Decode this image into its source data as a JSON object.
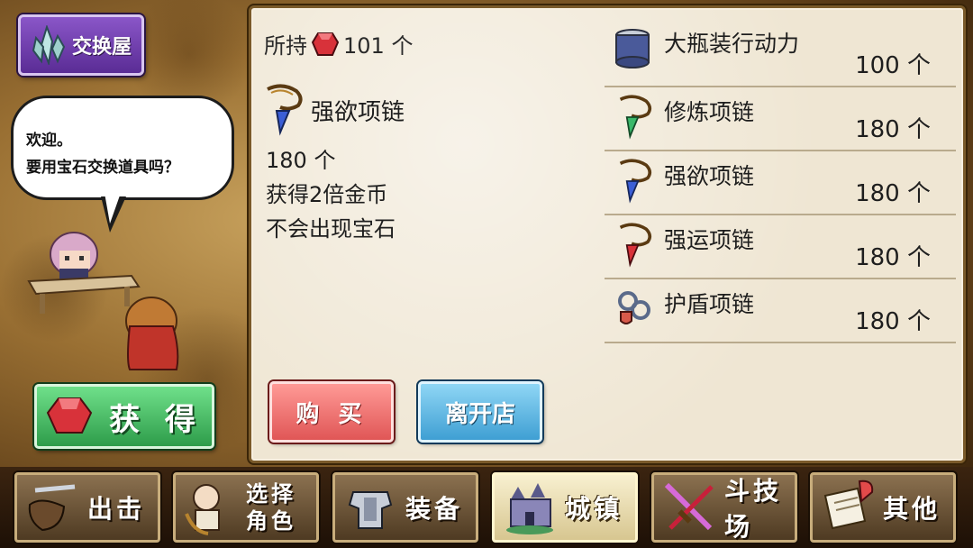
{
  "shop": {
    "title": "交换屋"
  },
  "npc": {
    "line1": "欢迎。",
    "line2": "要用宝石交换道具吗？"
  },
  "get_button": {
    "label": "获 得"
  },
  "owned": {
    "prefix": "所持",
    "amount": "101 个"
  },
  "selected": {
    "name": "强欲项链",
    "cost": "180 个",
    "effect1": "获得2倍金币",
    "effect2": "不会出现宝石"
  },
  "items": [
    {
      "name": "大瓶装行动力",
      "cost": "100 个",
      "icon": "potion-jar-icon"
    },
    {
      "name": "修炼项链",
      "cost": "180 个",
      "icon": "green-necklace-icon"
    },
    {
      "name": "强欲项链",
      "cost": "180 个",
      "icon": "blue-necklace-icon"
    },
    {
      "name": "强运项链",
      "cost": "180 个",
      "icon": "red-necklace-icon"
    },
    {
      "name": "护盾项链",
      "cost": "180 个",
      "icon": "shield-necklace-icon"
    }
  ],
  "actions": {
    "buy": "购 买",
    "leave": "离开店"
  },
  "nav": {
    "sortie": "出击",
    "select_line1": "选择",
    "select_line2": "角色",
    "equip": "装备",
    "town": "城镇",
    "arena": "斗技场",
    "other": "其他"
  },
  "colors": {
    "gem": "#d8323a",
    "panel": "#efe6d3",
    "shop_badge": "#6b3aa8"
  }
}
